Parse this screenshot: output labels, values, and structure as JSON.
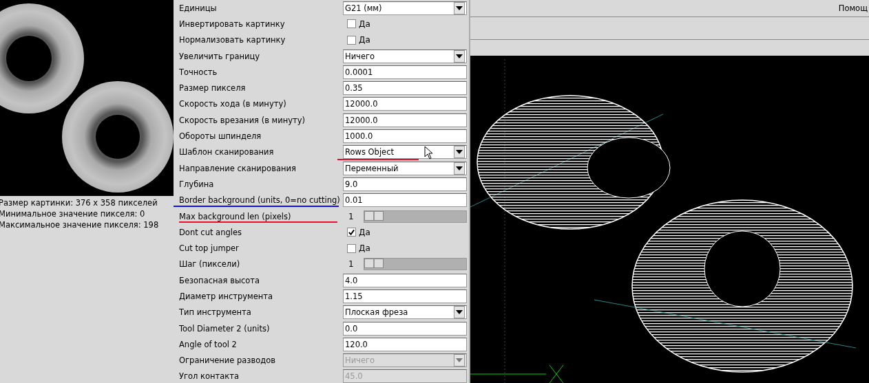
{
  "image_info": [
    "Размер картинки: 376 x 358 пикселей",
    "Минимальное значение пикселя: 0",
    "Максимальное значение пикселя: 198"
  ],
  "settings": [
    {
      "label": "Единицы",
      "kind": "select",
      "value": "G21 (мм)",
      "disabled": false
    },
    {
      "label": "Инвертировать картинку",
      "kind": "checkbox",
      "value": "Да",
      "checked": false
    },
    {
      "label": "Нормализовать картинку",
      "kind": "checkbox",
      "value": "Да",
      "checked": false
    },
    {
      "label": "Увеличить границу",
      "kind": "select",
      "value": "Ничего",
      "disabled": false
    },
    {
      "label": "Точность",
      "kind": "text",
      "value": "0.0001",
      "disabled": false
    },
    {
      "label": "Размер пикселя",
      "kind": "text",
      "value": "0.35",
      "disabled": false
    },
    {
      "label": "Скорость хода (в минуту)",
      "kind": "text",
      "value": "12000.0",
      "disabled": false
    },
    {
      "label": "Скорость врезания (в минуту)",
      "kind": "text",
      "value": "12000.0",
      "disabled": false
    },
    {
      "label": "Обороты шпинделя",
      "kind": "text",
      "value": "1000.0",
      "disabled": false
    },
    {
      "label": "Шаблон сканирования",
      "kind": "select",
      "value": "Rows Object",
      "disabled": false
    },
    {
      "label": "Направление сканирования",
      "kind": "select",
      "value": "Переменный",
      "disabled": false
    },
    {
      "label": "Глубина",
      "kind": "text",
      "value": "9.0",
      "disabled": false
    },
    {
      "label": "Border background (units, 0=no cutting)",
      "kind": "text",
      "value": "0.01",
      "disabled": false
    },
    {
      "label": "Max background len (pixels)",
      "kind": "slider",
      "value": "1",
      "level": 0
    },
    {
      "label": "Dont cut angles",
      "kind": "checkbox",
      "value": "Да",
      "checked": true
    },
    {
      "label": "Cut top jumper",
      "kind": "checkbox",
      "value": "Да",
      "checked": false
    },
    {
      "label": "Шаг (пиксели)",
      "kind": "slider",
      "value": "1",
      "level": 0
    },
    {
      "label": "Безопасная высота",
      "kind": "text",
      "value": "4.0",
      "disabled": false
    },
    {
      "label": "Диаметр инструмента",
      "kind": "text",
      "value": "1.15",
      "disabled": false
    },
    {
      "label": "Тип инструмента",
      "kind": "select",
      "value": "Плоская фреза",
      "disabled": false
    },
    {
      "label": "Tool Diameter 2 (units)",
      "kind": "text",
      "value": "0.0",
      "disabled": false
    },
    {
      "label": "Angle of tool 2",
      "kind": "text",
      "value": "120.0",
      "disabled": false
    },
    {
      "label": "Ограничение разводов",
      "kind": "select",
      "value": "Ничего",
      "disabled": true
    },
    {
      "label": "Угол контакта",
      "kind": "text",
      "value": "45.0",
      "disabled": true
    }
  ],
  "menu": {
    "label": "Помощ"
  }
}
